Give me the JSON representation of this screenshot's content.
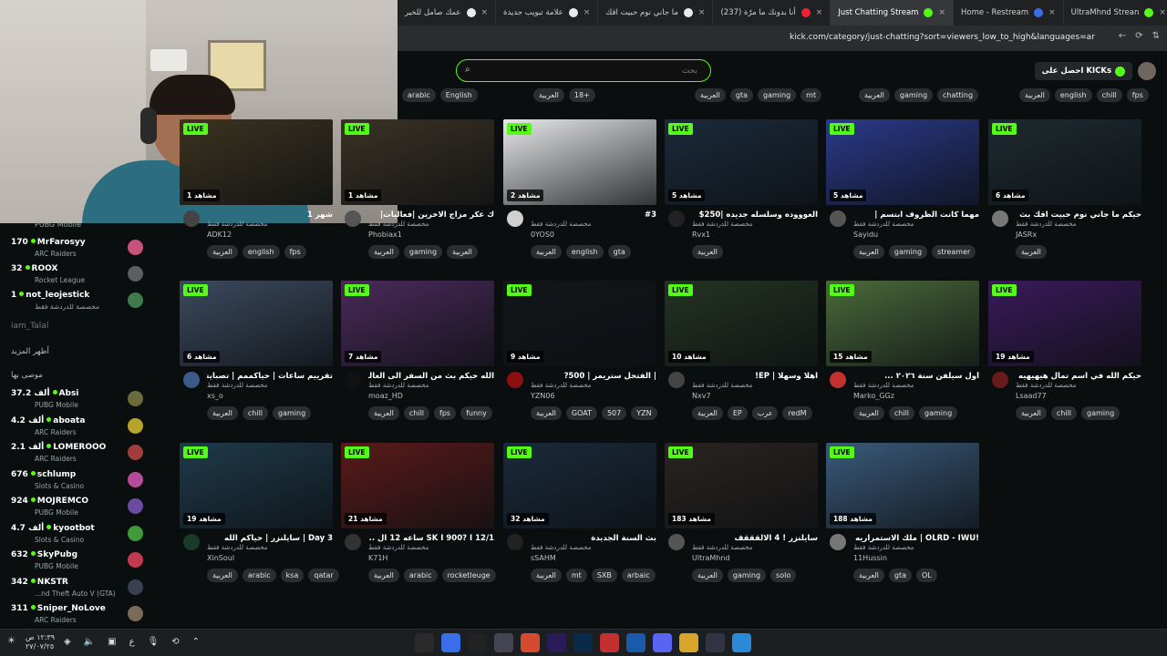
{
  "browser": {
    "tabs": [
      {
        "label": "UltraMhnd Strean",
        "icon": "kick-icon",
        "color": "#53fc18"
      },
      {
        "label": "Home - Restream",
        "icon": "restream-icon",
        "color": "#3a6ee8"
      },
      {
        "label": "Just Chatting Stream",
        "icon": "kick-icon",
        "color": "#53fc18"
      },
      {
        "label": "(237) أنا بدونك ما مرّة",
        "icon": "youtube-icon",
        "color": "#e23"
      },
      {
        "label": "ما جاني نوم حبيت اقك",
        "icon": "chrome-icon",
        "color": "#eaeaea"
      },
      {
        "label": "علامة تبويب جديدة",
        "icon": "chrome-icon",
        "color": "#eaeaea"
      },
      {
        "label": "عمك صامل للخير",
        "icon": "chrome-icon",
        "color": "#eaeaea"
      }
    ],
    "url": "kick.com/category/just-chatting?sort=viewers_low_to_high&languages=ar"
  },
  "header": {
    "search_placeholder": "بحث",
    "get_kicks": "احصل على KICKs"
  },
  "sidebar": {
    "cut_category": "PUBG Mobile",
    "following": [
      {
        "count": "170",
        "name": "MrFarosyy",
        "category": "ARC Raiders",
        "color": "#c9527b"
      },
      {
        "count": "32",
        "name": "ROOX",
        "category": "Rocket League",
        "color": "#5a5f63"
      },
      {
        "count": "1",
        "name": "not_leojestick",
        "category": "مخصصة للدردشة فقط",
        "color": "#3f7a4a"
      }
    ],
    "offline": "iam_Talal",
    "show_more": "أظهر المزيد",
    "recommended_label": "موصى بها",
    "recommended": [
      {
        "count": "37.2 ألف",
        "name": "Absi",
        "category": "PUBG Mobile",
        "color": "#6b6a3a"
      },
      {
        "count": "4.2 ألف",
        "name": "aboata",
        "category": "ARC Raiders",
        "color": "#b6a32a"
      },
      {
        "count": "2.1 ألف",
        "name": "LOMEROOO",
        "category": "ARC Raiders",
        "color": "#a23c3c"
      },
      {
        "count": "676",
        "name": "schlump",
        "category": "Slots & Casino",
        "color": "#b54b9a"
      },
      {
        "count": "924",
        "name": "MOJREMCO",
        "category": "PUBG Mobile",
        "color": "#6b4aa2"
      },
      {
        "count": "4.7 ألف",
        "name": "kyootbot",
        "category": "Slots & Casino",
        "color": "#3f9a3a"
      },
      {
        "count": "632",
        "name": "SkyPubg",
        "category": "PUBG Mobile",
        "color": "#c23a50"
      },
      {
        "count": "342",
        "name": "NKSTR",
        "category": "...nd Theft Auto V (GTA)",
        "color": "#3a3f52"
      },
      {
        "count": "311",
        "name": "Sniper_NoLove",
        "category": "ARC Raiders",
        "color": "#7a6a5a"
      }
    ]
  },
  "top_tags": [
    [
      "arabic",
      "English"
    ],
    [
      "العربية",
      "18+"
    ],
    [
      "العربية",
      "gta",
      "gaming",
      "mt"
    ],
    [
      "العربية",
      "gaming",
      "chatting"
    ],
    [
      "العربية",
      "english",
      "chill",
      "fps"
    ]
  ],
  "streams": [
    {
      "viewers": "1 مشاهد",
      "title": "شهر 1",
      "category": "مخصصة للدردشة فقط",
      "user": "ADK12",
      "tags": [
        "العربية",
        "english",
        "fps"
      ],
      "thumb": "#3b3320",
      "av": "#444"
    },
    {
      "viewers": "1 مشاهد",
      "title": "ك عكر مزاج الاخرين |فعاليات|",
      "category": "مخصصة للدردشة فقط",
      "user": "Phobiax1",
      "tags": [
        "العربية",
        "gaming",
        "العربية"
      ],
      "thumb": "#3a3225",
      "av": "#555"
    },
    {
      "viewers": "2 مشاهد",
      "title": "#3",
      "category": "مخصصة للدردشة فقط",
      "user": "0YOS0",
      "tags": [
        "العربية",
        "english",
        "gta"
      ],
      "thumb": "#e8e8ea",
      "av": "#d0d0d0"
    },
    {
      "viewers": "5 مشاهد",
      "title": "العوووده وسلسله جديده |250$",
      "category": "مخصصة للدردشة فقط",
      "user": "Rvx1",
      "tags": [
        "العربية"
      ],
      "thumb": "#1b2a3a",
      "av": "#222"
    },
    {
      "viewers": "5 مشاهد",
      "title": "مهما كانت الظروف ابتسم |",
      "category": "مخصصة للدردشة فقط",
      "user": "Sayidu",
      "tags": [
        "العربية",
        "gaming",
        "streamer"
      ],
      "thumb": "#2a3a8a",
      "av": "#555"
    },
    {
      "viewers": "6 مشاهد",
      "title": "حيكم ما جاني نوم حبيت اقك بث",
      "category": "مخصصة للدردشة فقط",
      "user": "JASRx",
      "tags": [
        "العربية"
      ],
      "thumb": "#1e2a30",
      "av": "#777"
    },
    {
      "viewers": "6 مشاهد",
      "title": "تقرييم ساعات | حياكممم | تصبايتي",
      "category": "مخصصة للدردشة فقط",
      "user": "xs_o",
      "tags": [
        "العربية",
        "chill",
        "gaming"
      ],
      "thumb": "#3c4a5e",
      "av": "#3a5a8a"
    },
    {
      "viewers": "7 مشاهد",
      "title": "الله حيكم بث من السفر الى العالمية",
      "category": "مخصصة للدردشة فقط",
      "user": "moaz_HD",
      "tags": [
        "العربية",
        "chill",
        "fps",
        "funny"
      ],
      "thumb": "#4a2a5a",
      "av": "#111"
    },
    {
      "viewers": "9 مشاهد",
      "title": "| الفتحل ستريمر | 500?",
      "category": "مخصصة للدردشة فقط",
      "user": "YZN06",
      "tags": [
        "العربية",
        "GOAT",
        "507",
        "YZN"
      ],
      "thumb": "#121619",
      "av": "#8a1010"
    },
    {
      "viewers": "10 مشاهد",
      "title": "اهلا وسهلا | EP!",
      "category": "مخصصة للدردشة فقط",
      "user": "Nxv7",
      "tags": [
        "العربية",
        "EP",
        "عرب",
        "redM"
      ],
      "thumb": "#243322",
      "av": "#444"
    },
    {
      "viewers": "15 مشاهد",
      "title": "أول سيلفن سنة ٢٠٢٦ ...",
      "category": "مخصصة للدردشة فقط",
      "user": "Marko_GGz",
      "tags": [
        "العربية",
        "chill",
        "gaming"
      ],
      "thumb": "#4a6a3a",
      "av": "#c23030"
    },
    {
      "viewers": "19 مشاهد",
      "title": "حيكم الله في اسم تمال هيهيهيه",
      "category": "مخصصة للدردشة فقط",
      "user": "Lsaad77",
      "tags": [
        "العربية",
        "chill",
        "gaming"
      ],
      "thumb": "#3a1a5a",
      "av": "#6a1a1a"
    },
    {
      "viewers": "19 مشاهد",
      "title": "Day 3 | سايلنزر | حياكم الله",
      "category": "مخصصة للدردشة فقط",
      "user": "XinSoul",
      "tags": [
        "العربية",
        "arabic",
        "ksa",
        "qatar"
      ],
      "thumb": "#1f3a4a",
      "av": "#1a3a2a"
    },
    {
      "viewers": "21 مشاهد",
      "title": "SK I 900? I 12/1 ساعه 12 ال ...!!",
      "category": "مخصصة للدردشة فقط",
      "user": "K71H",
      "tags": [
        "العربية",
        "arabic",
        "rocketleuge"
      ],
      "thumb": "#5a1a1a",
      "av": "#333"
    },
    {
      "viewers": "32 مشاهد",
      "title": "بث السنة الجديدة",
      "category": "مخصصة للدردشة فقط",
      "user": "sSAHM",
      "tags": [
        "العربية",
        "mt",
        "SXB",
        "arbaic"
      ],
      "thumb": "#1a2a3a",
      "av": "#222"
    },
    {
      "viewers": "183 مشاهد",
      "title": "سايلنزر ! 4 الالقققف",
      "category": "مخصصة للدردشة فقط",
      "user": "UltraMhnd",
      "tags": [
        "العربية",
        "gaming",
        "solo"
      ],
      "thumb": "#2a2420",
      "av": "#555"
    },
    {
      "viewers": "188 مشاهد",
      "title": "!OLRD - IWU | ملك الاستمراريه",
      "category": "مخصصة للدردشة فقط",
      "user": "11Hussin",
      "tags": [
        "العربية",
        "gta",
        "OL"
      ],
      "thumb": "#3a5a7a",
      "av": "#777"
    }
  ],
  "live_label": "LIVE",
  "taskbar": {
    "clock_time": "١٢:٣٩ ص",
    "clock_date": "٢٧/٠٧/٢٥",
    "lang": "ع",
    "apps": [
      {
        "icon": "obs-icon",
        "color": "#2a2a2a"
      },
      {
        "icon": "chrome-icon",
        "color": "#3a6ee8"
      },
      {
        "icon": "epic-icon",
        "color": "#222"
      },
      {
        "icon": "settings-icon",
        "color": "#445"
      },
      {
        "icon": "chrome-icon",
        "color": "#d64a30"
      },
      {
        "icon": "premiere-icon",
        "color": "#2a1a5a"
      },
      {
        "icon": "photoshop-icon",
        "color": "#0a2a4a"
      },
      {
        "icon": "capcut-icon",
        "color": "#c23030"
      },
      {
        "icon": "outlook-icon",
        "color": "#1a5aaa"
      },
      {
        "icon": "discord-icon",
        "color": "#5865f2"
      },
      {
        "icon": "folder-icon",
        "color": "#d8a52a"
      },
      {
        "icon": "store-icon",
        "color": "#334"
      },
      {
        "icon": "windows-icon",
        "color": "#2a8ad8"
      }
    ]
  }
}
